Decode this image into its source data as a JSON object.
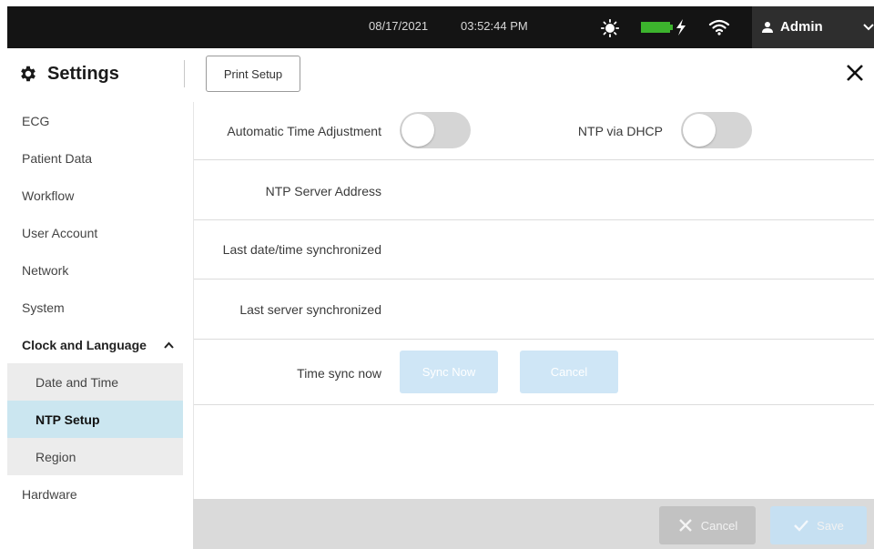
{
  "status_bar": {
    "date": "08/17/2021",
    "time": "03:52:44 PM",
    "icons": [
      "sun-icon",
      "battery-icon",
      "charging-bolt-icon",
      "wifi-icon"
    ],
    "battery_color": "#3cb32d",
    "user": "Admin"
  },
  "header": {
    "title": "Settings",
    "print_setup_label": "Print Setup",
    "icons": [
      "gear-icon",
      "close-icon"
    ]
  },
  "sidebar": {
    "items": [
      {
        "label": "ECG"
      },
      {
        "label": "Patient Data"
      },
      {
        "label": "Workflow"
      },
      {
        "label": "User Account"
      },
      {
        "label": "Network"
      },
      {
        "label": "System"
      },
      {
        "label": "Clock and Language",
        "expanded": true
      },
      {
        "label": "Date and Time"
      },
      {
        "label": "NTP Setup",
        "selected": true
      },
      {
        "label": "Region"
      },
      {
        "label": "Hardware"
      }
    ],
    "selected_color": "#cbe6f0"
  },
  "ntp": {
    "automatic_time_adjustment_label": "Automatic Time Adjustment",
    "automatic_time_adjustment_on": false,
    "ntp_via_dhcp_label": "NTP via DHCP",
    "ntp_via_dhcp_on": false,
    "server_address_label": "NTP Server Address",
    "last_datetime_sync_label": "Last date/time synchronized",
    "last_server_sync_label": "Last server synchronized",
    "time_sync_now_label": "Time sync now",
    "sync_now_label": "Sync Now",
    "cancel_label": "Cancel"
  },
  "footer": {
    "cancel_label": "Cancel",
    "save_label": "Save"
  }
}
